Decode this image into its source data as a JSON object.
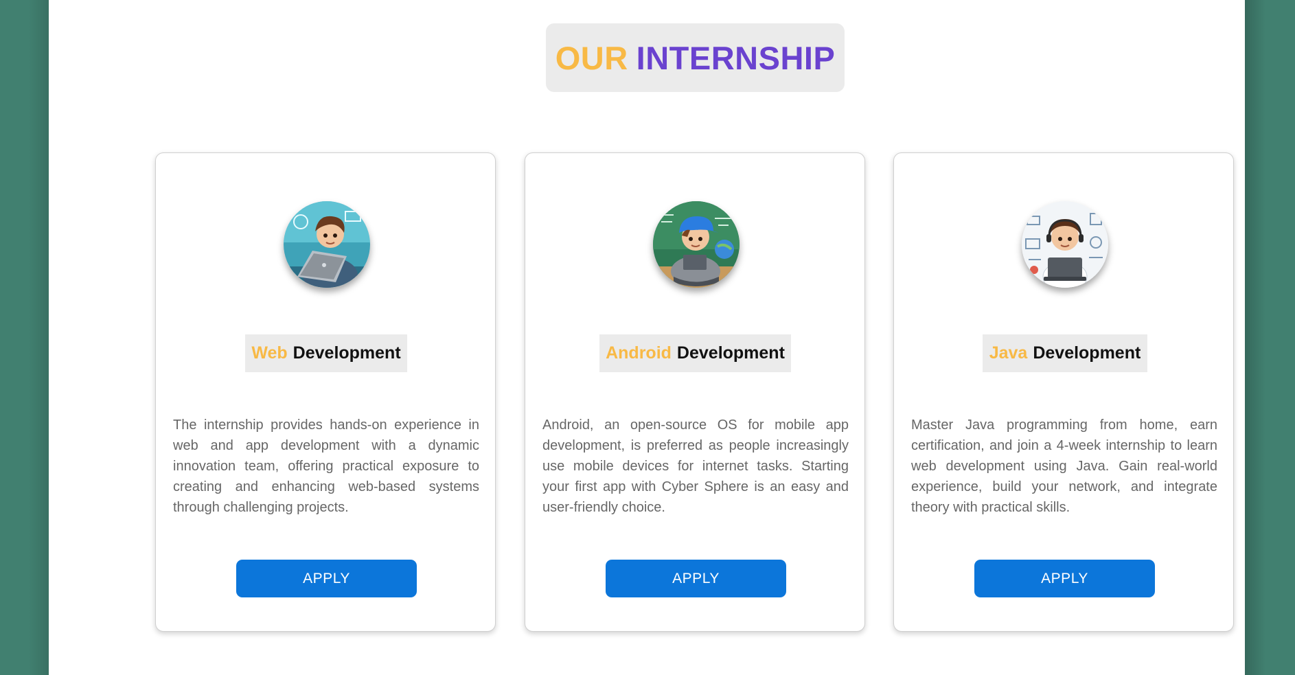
{
  "section": {
    "title_first": "OUR",
    "title_second": "INTERNSHIP"
  },
  "cards": [
    {
      "highlight": "Web",
      "title_rest": "Development",
      "description": "The internship provides hands-on experience in web and app development with a dynamic innovation team, offering practical exposure to creating and enhancing web-based systems through challenging projects.",
      "button_label": "APPLY",
      "avatar": "boy-with-laptop-avatar"
    },
    {
      "highlight": "Android",
      "title_rest": "Development",
      "description": "Android, an open-source OS for mobile app development, is preferred as people increasingly use mobile devices for internet tasks. Starting your first app with Cyber Sphere is an easy and user-friendly choice.",
      "button_label": "APPLY",
      "avatar": "boy-with-cap-tablet-avatar"
    },
    {
      "highlight": "Java",
      "title_rest": "Development",
      "description": "Master Java programming from home, earn certification, and join a 4-week internship to learn web development using Java. Gain real-world experience, build your network, and integrate theory with practical skills.",
      "button_label": "APPLY",
      "avatar": "boy-with-headset-avatar"
    }
  ],
  "colors": {
    "background": "#418070",
    "accent_orange": "#f8b945",
    "accent_purple": "#6a42cf",
    "button_blue": "#0c76da"
  }
}
